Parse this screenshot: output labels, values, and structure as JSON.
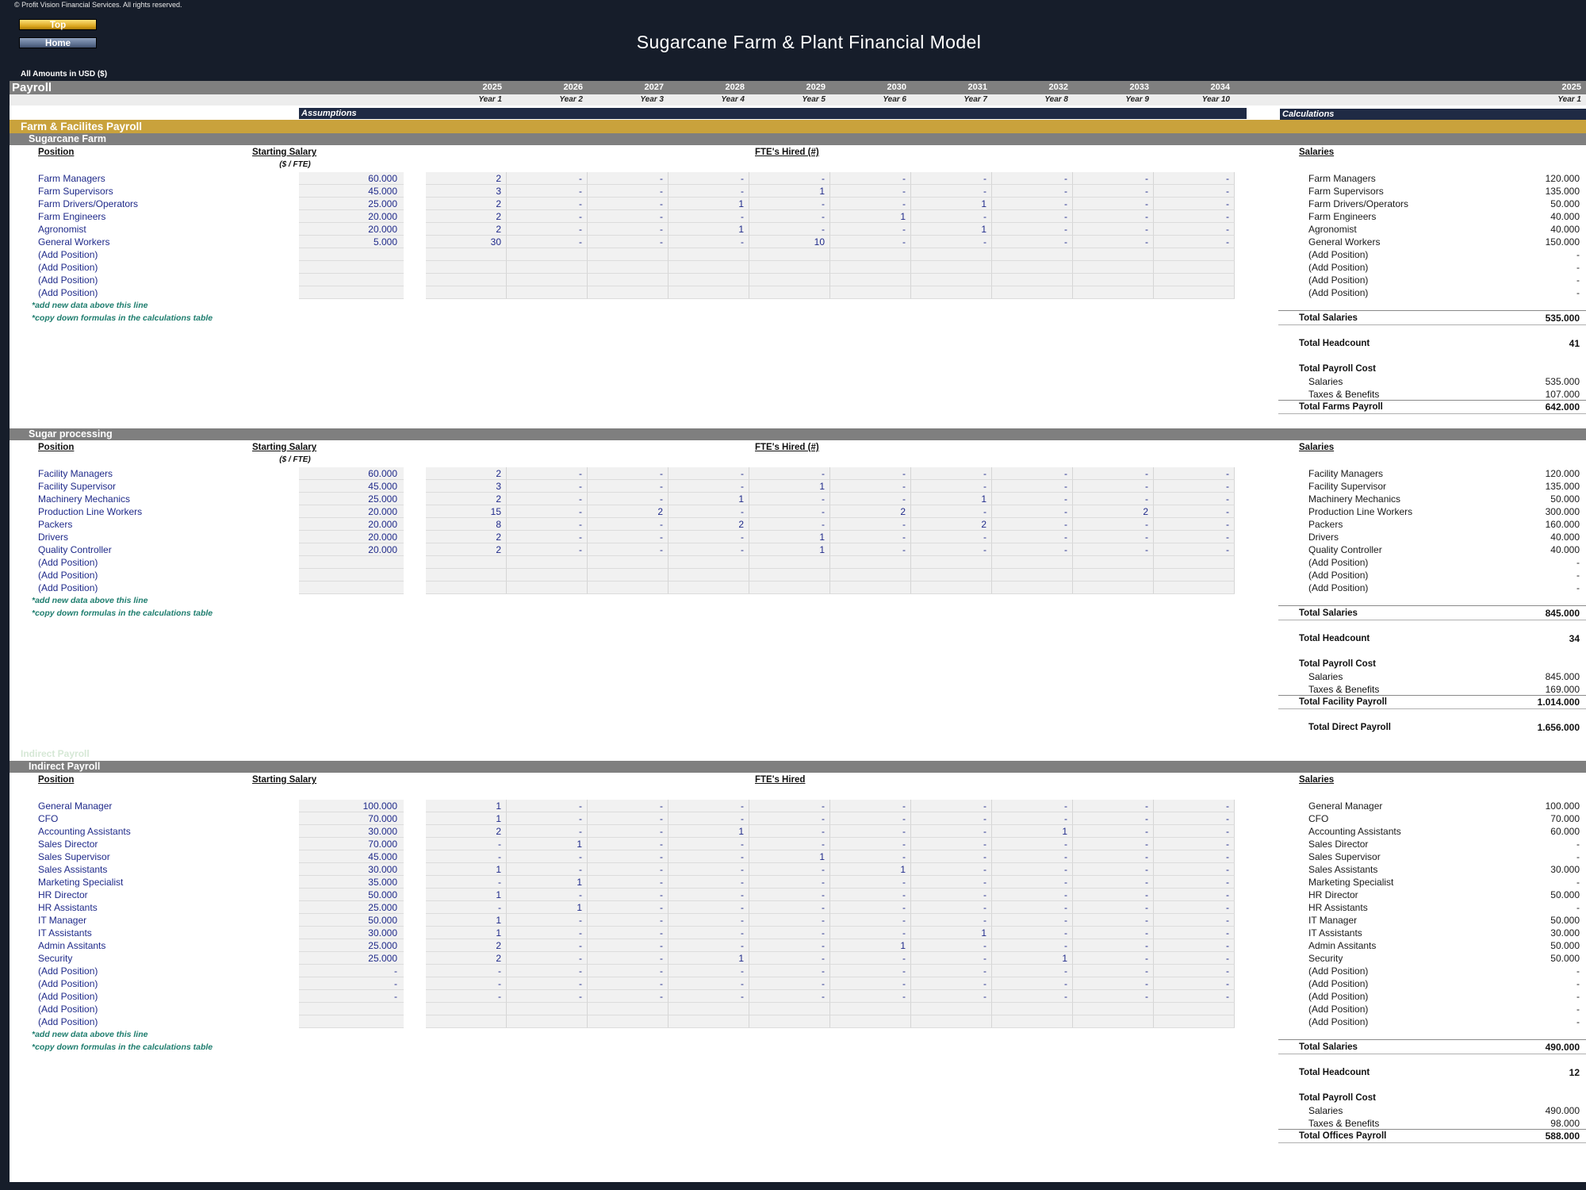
{
  "header": {
    "copyright": "© Profit Vision Financial Services. All rights reserved.",
    "nav_top": "Top",
    "nav_home": "Home",
    "title": "Sugarcane Farm & Plant Financial Model",
    "amounts": "All Amounts in  USD ($)"
  },
  "sheet": {
    "name": "Payroll",
    "years": [
      "2025",
      "2026",
      "2027",
      "2028",
      "2029",
      "2030",
      "2031",
      "2032",
      "2033",
      "2034"
    ],
    "year_labels": [
      "Year 1",
      "Year 2",
      "Year 3",
      "Year 4",
      "Year 5",
      "Year 6",
      "Year 7",
      "Year 8",
      "Year 9",
      "Year 10"
    ],
    "calc_year": "2025",
    "calc_year_label": "Year 1",
    "assumptions_label": "Assumptions",
    "calculations_label": "Calculations",
    "group_band": "Farm & Facilites Payroll",
    "ghost_text": "Indirect Payroll"
  },
  "sections": [
    {
      "band": "Sugarcane Farm",
      "position_hdr": "Position",
      "salary_hdr": "Starting Salary",
      "salary_sub": "($ / FTE)",
      "fte_hdr": "FTE's Hired (#)",
      "calc_hdr": "Salaries",
      "rows": [
        {
          "name": "Farm Managers",
          "salary": "60.000",
          "fte": [
            "2",
            "-",
            "-",
            "-",
            "-",
            "-",
            "-",
            "-",
            "-",
            "-"
          ],
          "calc": "120.000"
        },
        {
          "name": "Farm Supervisors",
          "salary": "45.000",
          "fte": [
            "3",
            "-",
            "-",
            "-",
            "1",
            "-",
            "-",
            "-",
            "-",
            "-"
          ],
          "calc": "135.000"
        },
        {
          "name": "Farm Drivers/Operators",
          "salary": "25.000",
          "fte": [
            "2",
            "-",
            "-",
            "1",
            "-",
            "-",
            "1",
            "-",
            "-",
            "-"
          ],
          "calc": "50.000"
        },
        {
          "name": "Farm Engineers",
          "salary": "20.000",
          "fte": [
            "2",
            "-",
            "-",
            "-",
            "-",
            "1",
            "-",
            "-",
            "-",
            "-"
          ],
          "calc": "40.000"
        },
        {
          "name": "Agronomist",
          "salary": "20.000",
          "fte": [
            "2",
            "-",
            "-",
            "1",
            "-",
            "-",
            "1",
            "-",
            "-",
            "-"
          ],
          "calc": "40.000"
        },
        {
          "name": "General Workers",
          "salary": "5.000",
          "fte": [
            "30",
            "-",
            "-",
            "-",
            "10",
            "-",
            "-",
            "-",
            "-",
            "-"
          ],
          "calc": "150.000"
        },
        {
          "name": "(Add Position)",
          "salary": "",
          "fte": [
            "",
            "",
            "",
            "",
            "",
            "",
            "",
            "",
            "",
            ""
          ],
          "calc": "-"
        },
        {
          "name": "(Add Position)",
          "salary": "",
          "fte": [
            "",
            "",
            "",
            "",
            "",
            "",
            "",
            "",
            "",
            ""
          ],
          "calc": "-"
        },
        {
          "name": "(Add Position)",
          "salary": "",
          "fte": [
            "",
            "",
            "",
            "",
            "",
            "",
            "",
            "",
            "",
            ""
          ],
          "calc": "-"
        },
        {
          "name": "(Add Position)",
          "salary": "",
          "fte": [
            "",
            "",
            "",
            "",
            "",
            "",
            "",
            "",
            "",
            ""
          ],
          "calc": "-"
        }
      ],
      "note1": "*add new data above this line",
      "note2": "*copy down formulas in the calculations table",
      "totals": [
        {
          "label": "Total Salaries",
          "value": "535.000",
          "kind": "bold"
        },
        {
          "label": "Total Headcount",
          "value": "41",
          "kind": "bold"
        },
        {
          "label": "Total Payroll Cost",
          "value": "",
          "kind": "bold"
        },
        {
          "label": "Salaries",
          "value": "535.000",
          "kind": "sub"
        },
        {
          "label": "Taxes & Benefits",
          "value": "107.000",
          "kind": "sub"
        },
        {
          "label": "Total Farms Payroll",
          "value": "642.000",
          "kind": "bold"
        }
      ]
    },
    {
      "band": "Sugar processing",
      "position_hdr": "Position",
      "salary_hdr": "Starting Salary",
      "salary_sub": "($ / FTE)",
      "fte_hdr": "FTE's Hired (#)",
      "calc_hdr": "Salaries",
      "rows": [
        {
          "name": "Facility Managers",
          "salary": "60.000",
          "fte": [
            "2",
            "-",
            "-",
            "-",
            "-",
            "-",
            "-",
            "-",
            "-",
            "-"
          ],
          "calc": "120.000"
        },
        {
          "name": "Facility Supervisor",
          "salary": "45.000",
          "fte": [
            "3",
            "-",
            "-",
            "-",
            "1",
            "-",
            "-",
            "-",
            "-",
            "-"
          ],
          "calc": "135.000"
        },
        {
          "name": "Machinery Mechanics",
          "salary": "25.000",
          "fte": [
            "2",
            "-",
            "-",
            "1",
            "-",
            "-",
            "1",
            "-",
            "-",
            "-"
          ],
          "calc": "50.000"
        },
        {
          "name": "Production Line Workers",
          "salary": "20.000",
          "fte": [
            "15",
            "-",
            "2",
            "-",
            "-",
            "2",
            "-",
            "-",
            "2",
            "-"
          ],
          "calc": "300.000"
        },
        {
          "name": "Packers",
          "salary": "20.000",
          "fte": [
            "8",
            "-",
            "-",
            "2",
            "-",
            "-",
            "2",
            "-",
            "-",
            "-"
          ],
          "calc": "160.000"
        },
        {
          "name": "Drivers",
          "salary": "20.000",
          "fte": [
            "2",
            "-",
            "-",
            "-",
            "1",
            "-",
            "-",
            "-",
            "-",
            "-"
          ],
          "calc": "40.000"
        },
        {
          "name": "Quality Controller",
          "salary": "20.000",
          "fte": [
            "2",
            "-",
            "-",
            "-",
            "1",
            "-",
            "-",
            "-",
            "-",
            "-"
          ],
          "calc": "40.000"
        },
        {
          "name": "(Add Position)",
          "salary": "",
          "fte": [
            "",
            "",
            "",
            "",
            "",
            "",
            "",
            "",
            "",
            ""
          ],
          "calc": "-"
        },
        {
          "name": "(Add Position)",
          "salary": "",
          "fte": [
            "",
            "",
            "",
            "",
            "",
            "",
            "",
            "",
            "",
            ""
          ],
          "calc": "-"
        },
        {
          "name": "(Add Position)",
          "salary": "",
          "fte": [
            "",
            "",
            "",
            "",
            "",
            "",
            "",
            "",
            "",
            ""
          ],
          "calc": "-"
        }
      ],
      "note1": "*add new data above this line",
      "note2": "*copy down formulas in the calculations table",
      "totals": [
        {
          "label": "Total Salaries",
          "value": "845.000",
          "kind": "bold"
        },
        {
          "label": "Total Headcount",
          "value": "34",
          "kind": "bold"
        },
        {
          "label": "Total Payroll Cost",
          "value": "",
          "kind": "bold"
        },
        {
          "label": "Salaries",
          "value": "845.000",
          "kind": "sub"
        },
        {
          "label": "Taxes & Benefits",
          "value": "169.000",
          "kind": "sub"
        },
        {
          "label": "Total Facility Payroll",
          "value": "1.014.000",
          "kind": "bold"
        },
        {
          "label": "Total Direct Payroll",
          "value": "1.656.000",
          "kind": "direct"
        }
      ]
    },
    {
      "band": "Indirect Payroll",
      "position_hdr": "Position",
      "salary_hdr": "Starting Salary",
      "salary_sub": "",
      "fte_hdr": "FTE's Hired",
      "calc_hdr": "Salaries",
      "rows": [
        {
          "name": "General Manager",
          "salary": "100.000",
          "fte": [
            "1",
            "-",
            "-",
            "-",
            "-",
            "-",
            "-",
            "-",
            "-",
            "-"
          ],
          "calc": "100.000"
        },
        {
          "name": "CFO",
          "salary": "70.000",
          "fte": [
            "1",
            "-",
            "-",
            "-",
            "-",
            "-",
            "-",
            "-",
            "-",
            "-"
          ],
          "calc": "70.000"
        },
        {
          "name": "Accounting Assistants",
          "salary": "30.000",
          "fte": [
            "2",
            "-",
            "-",
            "1",
            "-",
            "-",
            "-",
            "1",
            "-",
            "-"
          ],
          "calc": "60.000"
        },
        {
          "name": "Sales Director",
          "salary": "70.000",
          "fte": [
            "-",
            "1",
            "-",
            "-",
            "-",
            "-",
            "-",
            "-",
            "-",
            "-"
          ],
          "calc": "-"
        },
        {
          "name": "Sales Supervisor",
          "salary": "45.000",
          "fte": [
            "-",
            "-",
            "-",
            "-",
            "1",
            "-",
            "-",
            "-",
            "-",
            "-"
          ],
          "calc": "-"
        },
        {
          "name": "Sales Assistants",
          "salary": "30.000",
          "fte": [
            "1",
            "-",
            "-",
            "-",
            "-",
            "1",
            "-",
            "-",
            "-",
            "-"
          ],
          "calc": "30.000"
        },
        {
          "name": "Marketing Specialist",
          "salary": "35.000",
          "fte": [
            "-",
            "1",
            "-",
            "-",
            "-",
            "-",
            "-",
            "-",
            "-",
            "-"
          ],
          "calc": "-"
        },
        {
          "name": "HR Director",
          "salary": "50.000",
          "fte": [
            "1",
            "-",
            "-",
            "-",
            "-",
            "-",
            "-",
            "-",
            "-",
            "-"
          ],
          "calc": "50.000"
        },
        {
          "name": "HR Assistants",
          "salary": "25.000",
          "fte": [
            "-",
            "1",
            "-",
            "-",
            "-",
            "-",
            "-",
            "-",
            "-",
            "-"
          ],
          "calc": "-"
        },
        {
          "name": "IT Manager",
          "salary": "50.000",
          "fte": [
            "1",
            "-",
            "-",
            "-",
            "-",
            "-",
            "-",
            "-",
            "-",
            "-"
          ],
          "calc": "50.000"
        },
        {
          "name": "IT Assistants",
          "salary": "30.000",
          "fte": [
            "1",
            "-",
            "-",
            "-",
            "-",
            "-",
            "1",
            "-",
            "-",
            "-"
          ],
          "calc": "30.000"
        },
        {
          "name": "Admin Assitants",
          "salary": "25.000",
          "fte": [
            "2",
            "-",
            "-",
            "-",
            "-",
            "1",
            "-",
            "-",
            "-",
            "-"
          ],
          "calc": "50.000"
        },
        {
          "name": "Security",
          "salary": "25.000",
          "fte": [
            "2",
            "-",
            "-",
            "1",
            "-",
            "-",
            "-",
            "1",
            "-",
            "-"
          ],
          "calc": "50.000"
        },
        {
          "name": "(Add Position)",
          "salary": "-",
          "fte": [
            "-",
            "-",
            "-",
            "-",
            "-",
            "-",
            "-",
            "-",
            "-",
            "-"
          ],
          "calc": "-"
        },
        {
          "name": "(Add Position)",
          "salary": "-",
          "fte": [
            "-",
            "-",
            "-",
            "-",
            "-",
            "-",
            "-",
            "-",
            "-",
            "-"
          ],
          "calc": "-"
        },
        {
          "name": "(Add Position)",
          "salary": "-",
          "fte": [
            "-",
            "-",
            "-",
            "-",
            "-",
            "-",
            "-",
            "-",
            "-",
            "-"
          ],
          "calc": "-"
        },
        {
          "name": "(Add Position)",
          "salary": "",
          "fte": [
            "",
            "",
            "",
            "",
            "",
            "",
            "",
            "",
            "",
            ""
          ],
          "calc": "-"
        },
        {
          "name": "(Add Position)",
          "salary": "",
          "fte": [
            "",
            "",
            "",
            "",
            "",
            "",
            "",
            "",
            "",
            ""
          ],
          "calc": "-"
        }
      ],
      "note1": "*add new data above this line",
      "note2": "*copy down formulas in the calculations table",
      "totals": [
        {
          "label": "Total Salaries",
          "value": "490.000",
          "kind": "bold"
        },
        {
          "label": "Total Headcount",
          "value": "12",
          "kind": "bold"
        },
        {
          "label": "Total Payroll Cost",
          "value": "",
          "kind": "bold"
        },
        {
          "label": "Salaries",
          "value": "490.000",
          "kind": "sub"
        },
        {
          "label": "Taxes & Benefits",
          "value": "98.000",
          "kind": "sub"
        },
        {
          "label": "Total Offices Payroll",
          "value": "588.000",
          "kind": "bold"
        }
      ]
    }
  ]
}
